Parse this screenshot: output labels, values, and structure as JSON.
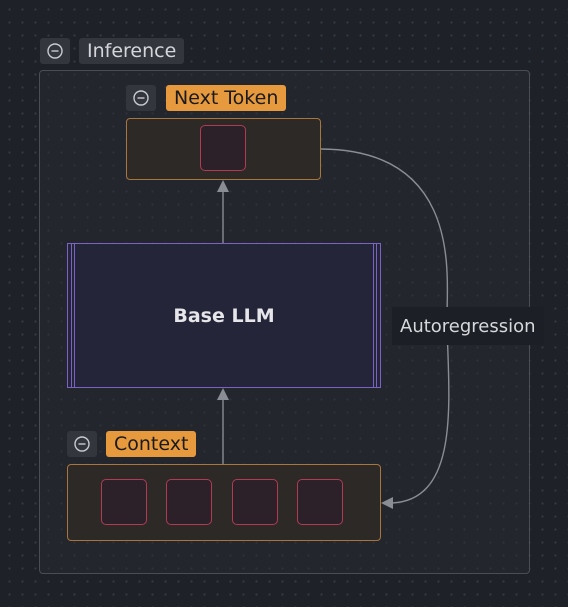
{
  "groups": {
    "inference": {
      "title": "Inference"
    },
    "next_token": {
      "title": "Next Token",
      "token_count": 1
    },
    "context": {
      "title": "Context",
      "token_count": 4
    }
  },
  "nodes": {
    "base_llm": {
      "label": "Base LLM"
    }
  },
  "edges": {
    "autoregression": {
      "label": "Autoregression"
    }
  },
  "colors": {
    "background": "#1e2128",
    "tensor_border": "#a8763d",
    "token_border": "#b03b52",
    "title_chip": "#e79a3d",
    "llm_border": "#7a63c2",
    "edge": "#8a8d94"
  },
  "icons": {
    "collapse": "minus-circle-icon"
  }
}
